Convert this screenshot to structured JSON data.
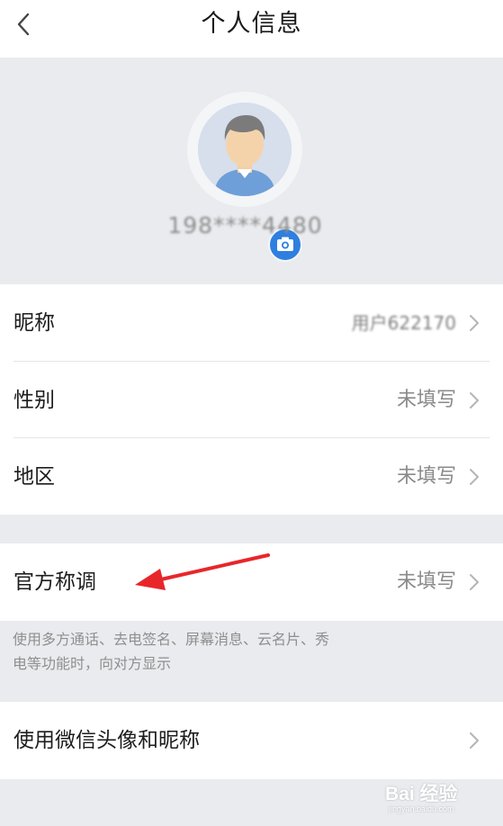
{
  "header": {
    "title": "个人信息",
    "back_icon": "chevron-left-icon"
  },
  "profile": {
    "phone": "198****4480",
    "avatar_icon": "default-avatar-icon",
    "camera_icon": "camera-icon",
    "camera_color": "#2f7fe0"
  },
  "basic_info": [
    {
      "label": "昵称",
      "value": "用户622170"
    },
    {
      "label": "性别",
      "value": "未填写"
    },
    {
      "label": "地区",
      "value": "未填写"
    }
  ],
  "official_title": {
    "label": "官方称调",
    "value": "未填写",
    "note": "使用多方通话、去电签名、屏幕消息、云名片、秀电等功能时，向对方显示"
  },
  "wechat": {
    "label": "使用微信头像和昵称"
  },
  "annotation": {
    "arrow_color": "#e8262a"
  },
  "watermark": {
    "text": "Bai 经验",
    "sub": "jingyan.baidu.com"
  },
  "colors": {
    "background": "#e9ebee",
    "card": "#ffffff",
    "secondary_text": "#8a8a8a"
  }
}
